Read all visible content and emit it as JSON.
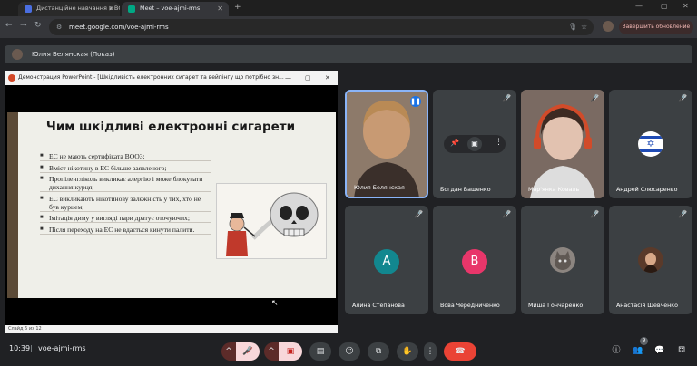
{
  "browser": {
    "tabs": [
      {
        "title": "Дистанційне навчання в ВСП",
        "active": false
      },
      {
        "title": "Meet – voe-ajmi-rms",
        "active": true
      }
    ],
    "new_tab_icon": "plus-icon",
    "url": "meet.google.com/voe-ajmi-rms",
    "update_button": "Завершить обновление"
  },
  "presenter_bar": {
    "label": "Юлия Белянская (Показ)"
  },
  "ppt": {
    "window_title": "Демонстрация PowerPoint - [Шкідливість електронних сигарет та вейпінгу що потрібно зн...",
    "slide_title": "Чим шкідливі електронні сигарети",
    "bullets": [
      "ЕС не мають сертифіката ВООЗ;",
      " Вміст нікотину в ЕС більше заявленого;",
      "Пропіленгліколь викликає алергію і може блокувати дихання курця;",
      "ЕС викликають нікотинову залежність у тих, хто не був курцем;",
      "Імітація диму у вигляді пари дратує оточуючих;",
      "Після переходу на ЕС не вдається кинути палити."
    ],
    "status": "Слайд 6 из 12"
  },
  "participants": [
    {
      "name": "Юлия Белянская"
    },
    {
      "name": "Богдан Ващенко"
    },
    {
      "name": "Мар'янка Коваль"
    },
    {
      "name": "Андрей Слюсаренко"
    },
    {
      "name": "Алина Степанова",
      "initial": "А",
      "color": "#12878f"
    },
    {
      "name": "Вова Чередниченко",
      "initial": "В",
      "color": "#e8366a"
    },
    {
      "name": "Миша Гончаренко"
    },
    {
      "name": "Анастасія Шевченко"
    }
  ],
  "bottom": {
    "time": "10:39",
    "separator": "|",
    "meeting_code": "voe-ajmi-rms",
    "people_count": "9"
  },
  "colors": {
    "accent_red": "#ea4335",
    "background": "#202124",
    "tile": "#3c4043"
  }
}
